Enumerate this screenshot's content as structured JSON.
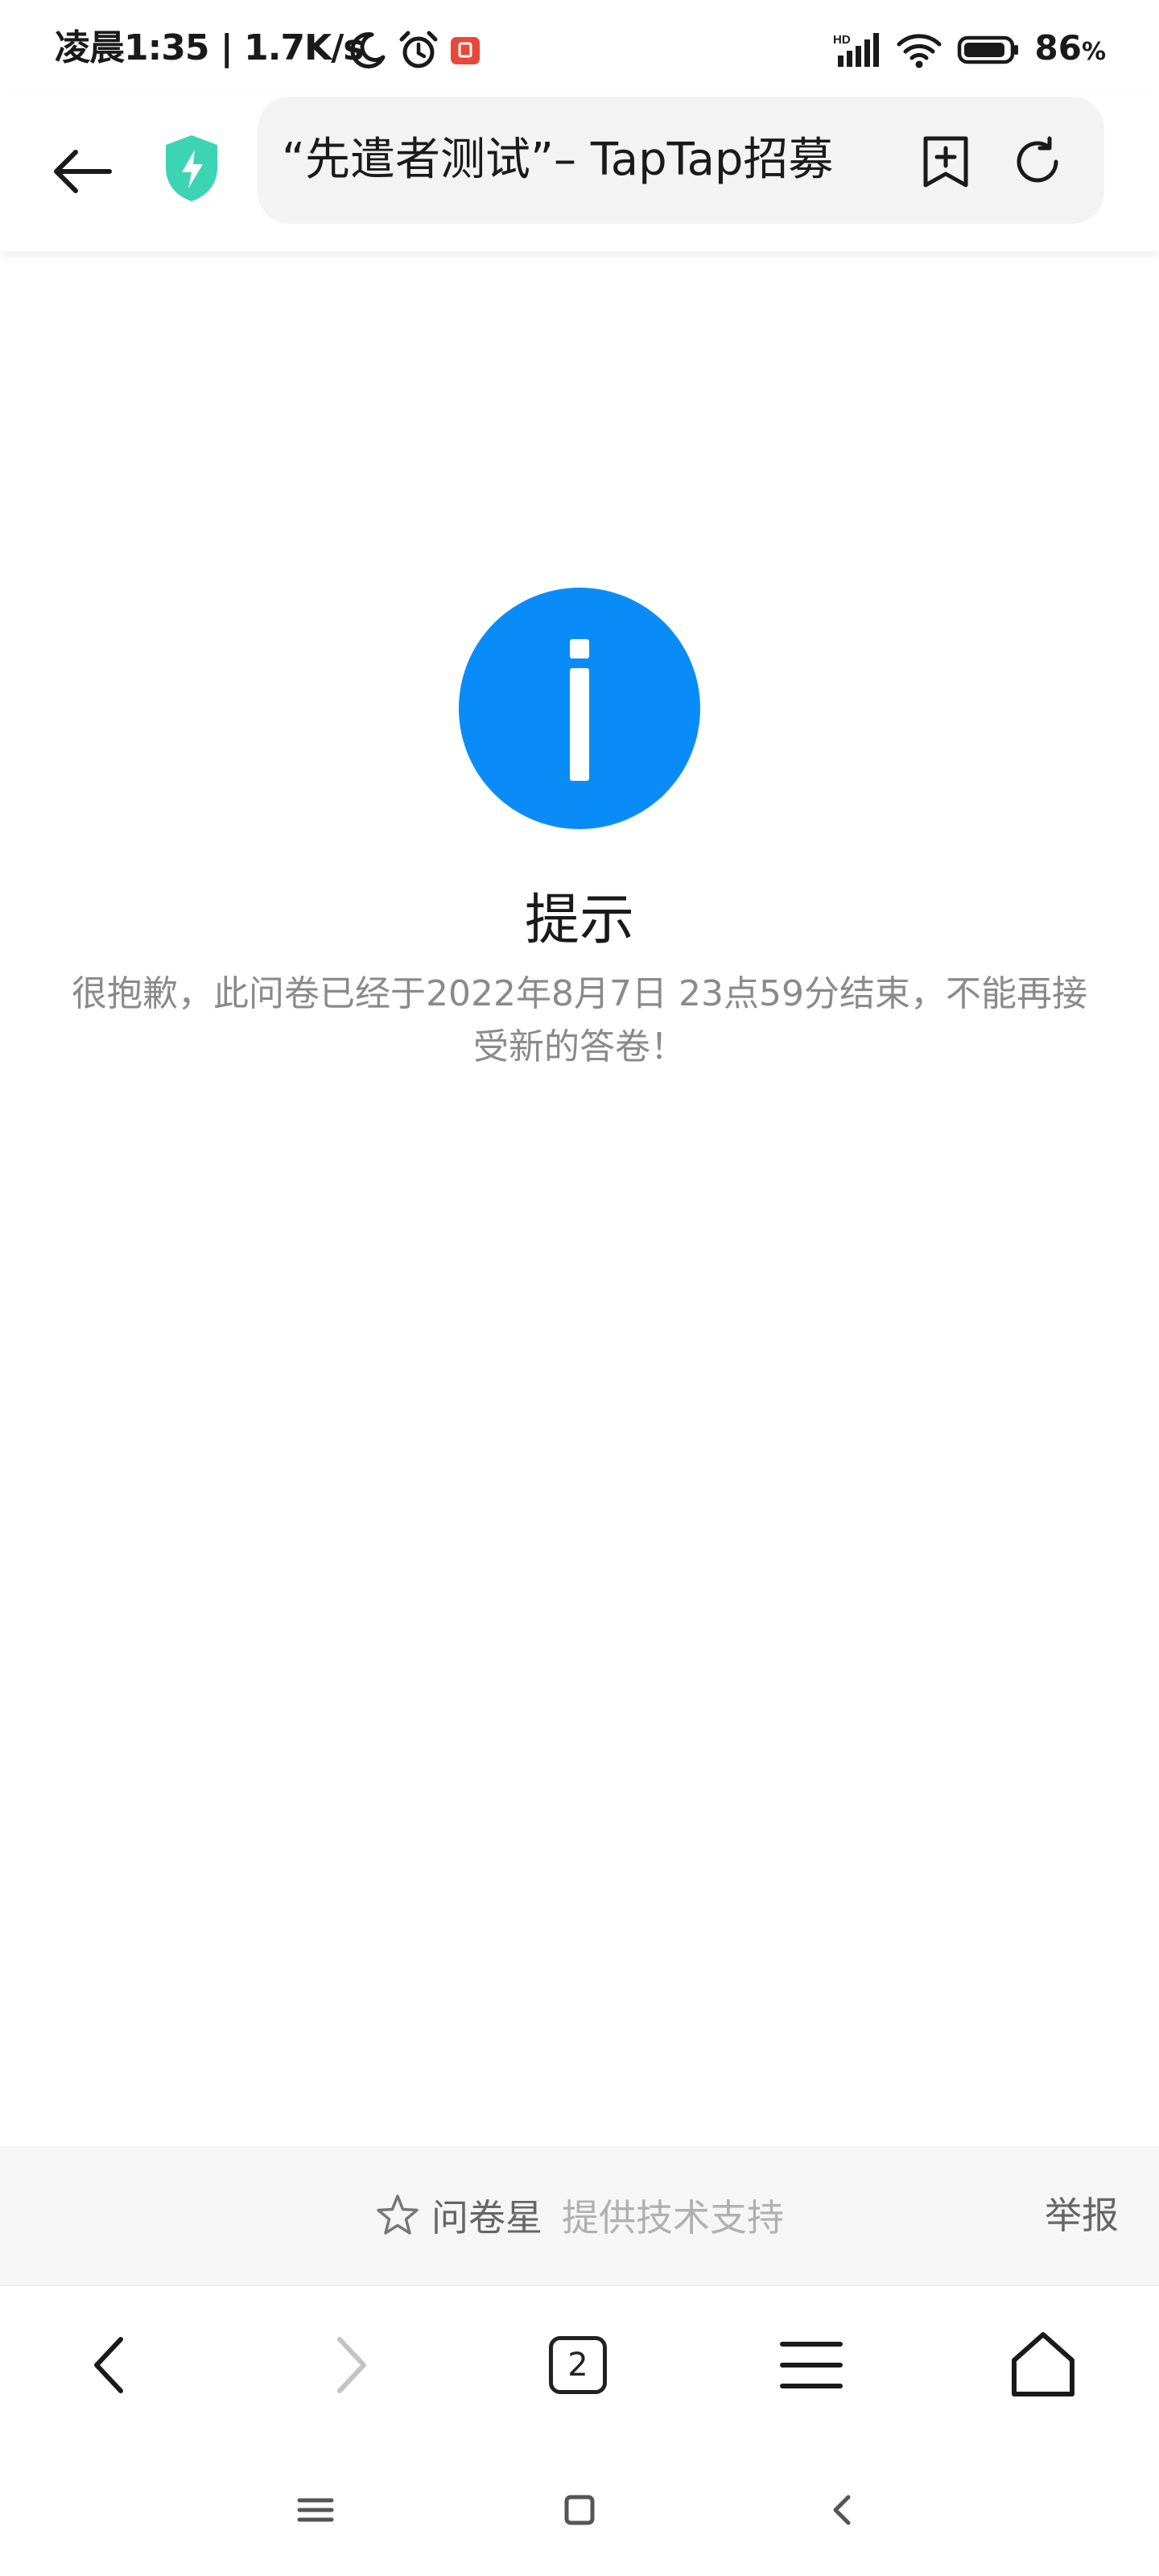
{
  "status_bar": {
    "time_and_speed": "凌晨1:35 | 1.7K/s",
    "network_badge": "HD",
    "battery_value": "86",
    "battery_unit": "%"
  },
  "toolbar": {
    "url_title": "“先遣者测试”– TapTap招募"
  },
  "notice": {
    "title": "提示",
    "message": "很抱歉，此问卷已经于2022年8月7日 23点59分结束，不能再接受新的答卷！"
  },
  "footer": {
    "brand_name": "问卷星",
    "support_text": "提供技术支持",
    "report_label": "举报"
  },
  "browser_nav": {
    "tab_count": "2"
  },
  "icons": {
    "status": [
      "moon-icon",
      "alarm-icon",
      "app-notification-icon",
      "signal-icon",
      "wifi-icon",
      "battery-icon"
    ],
    "toolbar": [
      "back-arrow-icon",
      "security-shield-icon",
      "add-bookmark-icon",
      "refresh-icon"
    ],
    "content": [
      "info-icon"
    ],
    "footer": [
      "star-icon"
    ],
    "browser_nav": [
      "chevron-left-icon",
      "chevron-right-icon",
      "tabs-icon",
      "menu-icon",
      "home-icon"
    ],
    "system_nav": [
      "recents-icon",
      "home-square-icon",
      "system-back-icon"
    ]
  },
  "colors": {
    "accent_blue": "#0A8CF8",
    "shield_teal": "#3CD4B4",
    "notification_red": "#E8483A"
  }
}
